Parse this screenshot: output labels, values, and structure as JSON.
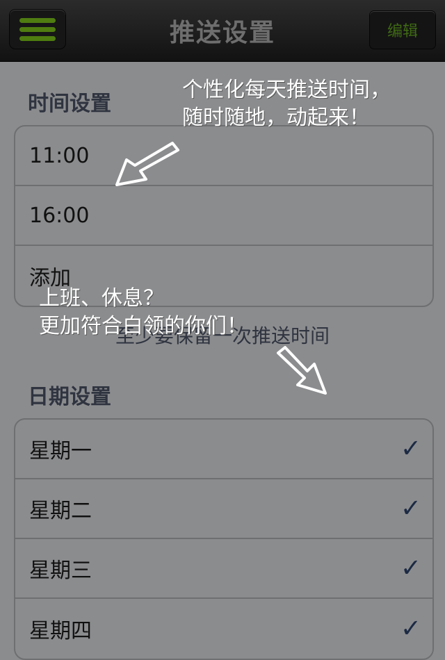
{
  "header": {
    "title": "推送设置",
    "edit_label": "编辑",
    "menu_icon": "menu-icon"
  },
  "time_section": {
    "title": "时间设置",
    "items": [
      {
        "label": "11:00"
      },
      {
        "label": "16:00"
      },
      {
        "label": "添加"
      }
    ],
    "hint": "至少要保留一次推送时间"
  },
  "date_section": {
    "title": "日期设置",
    "items": [
      {
        "label": "星期一",
        "checked": true
      },
      {
        "label": "星期二",
        "checked": true
      },
      {
        "label": "星期三",
        "checked": true
      },
      {
        "label": "星期四",
        "checked": true
      }
    ]
  },
  "annotations": {
    "top_line1": "个性化每天推送时间，",
    "top_line2": "随时随地，动起来！",
    "mid_line1": "上班、休息？",
    "mid_line2": "更加符合白领的你们！"
  },
  "colors": {
    "accent_green": "#4f7d10",
    "check": "#1c2a44",
    "overlay_bg": "#8b8c8e"
  }
}
